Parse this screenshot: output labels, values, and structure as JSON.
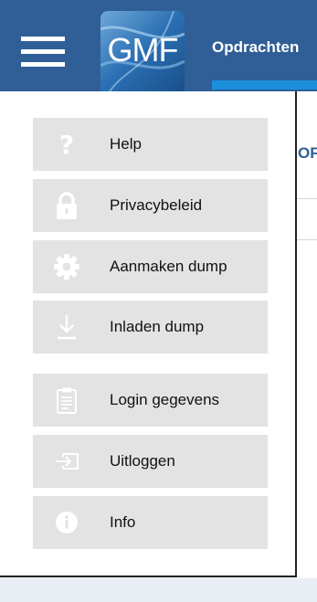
{
  "header": {
    "logo_text": "GMF",
    "title": "Opdrachten"
  },
  "background": {
    "heading_fragment": "OF"
  },
  "menu": {
    "items": [
      {
        "label": "Help",
        "icon": "question-icon"
      },
      {
        "label": "Privacybeleid",
        "icon": "lock-icon"
      },
      {
        "label": "Aanmaken dump",
        "icon": "gear-icon"
      },
      {
        "label": "Inladen dump",
        "icon": "download-icon"
      },
      {
        "label": "Login gegevens",
        "icon": "clipboard-icon"
      },
      {
        "label": "Uitloggen",
        "icon": "logout-icon"
      },
      {
        "label": "Info",
        "icon": "info-icon"
      }
    ]
  },
  "colors": {
    "header_bg": "#2f5f96",
    "accent": "#1c8fdc",
    "menu_item_bg": "#e3e3e3",
    "icon_color": "#ffffff"
  }
}
